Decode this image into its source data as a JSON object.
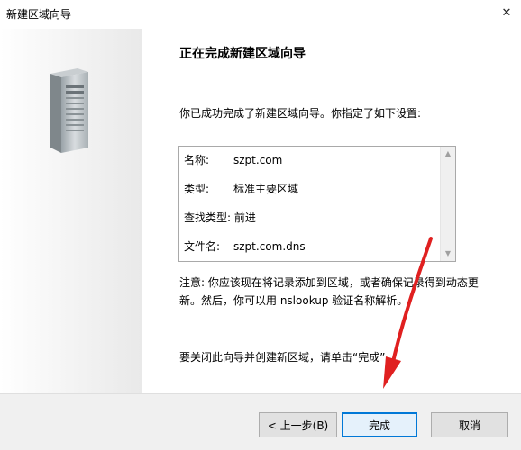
{
  "window": {
    "title": "新建区域向导",
    "close_glyph": "✕"
  },
  "wizard": {
    "heading": "正在完成新建区域向导",
    "intro": "你已成功完成了新建区域向导。你指定了如下设置:",
    "summary": [
      {
        "key": "名称:",
        "value": "szpt.com"
      },
      {
        "key": "类型:",
        "value": "标准主要区域"
      },
      {
        "key": "查找类型:",
        "value": "前进"
      },
      {
        "key": "文件名:",
        "value": "szpt.com.dns"
      }
    ],
    "note": "注意: 你应该现在将记录添加到区域，或者确保记录得到动态更新。然后，你可以用 nslookup 验证名称解析。",
    "finish_hint": "要关闭此向导并创建新区域，请单击“完成”。"
  },
  "buttons": {
    "back": "< 上一步(B)",
    "finish": "完成",
    "cancel": "取消"
  },
  "colors": {
    "accent": "#0078d7",
    "annotation_arrow": "#e02020"
  }
}
